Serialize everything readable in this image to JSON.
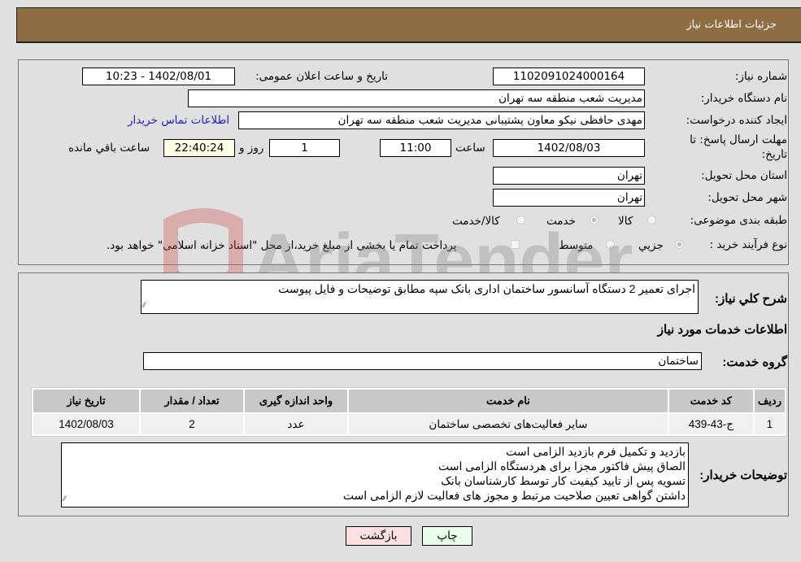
{
  "header": {
    "title": "جزئیات اطلاعات نیاز"
  },
  "form": {
    "need_number": {
      "label": "شماره نیاز:",
      "value": "1102091024000164"
    },
    "announce_datetime": {
      "label": "تاریخ و ساعت اعلان عمومی:",
      "value": "1402/08/01 - 10:23"
    },
    "buyer_org": {
      "label": "نام دستگاه خریدار:",
      "value": "مدیریت شعب منطقه سه تهران"
    },
    "requester": {
      "label": "ایجاد کننده درخواست:",
      "value": "مهدی حافظی نیکو معاون پشتیبانی مدیریت شعب منطقه سه تهران"
    },
    "contact_link": "اطلاعات تماس خریدار",
    "deadline": {
      "label_line1": "مهلت ارسال پاسخ: تا",
      "label_line2": "تاریخ:",
      "date": "1402/08/03",
      "time_label": "ساعت",
      "time": "11:00",
      "days": "1",
      "days_label": "روز و",
      "remaining": "22:40:24",
      "remaining_label": "ساعت باقي مانده"
    },
    "province": {
      "label": "استان محل تحویل:",
      "value": "تهران"
    },
    "city": {
      "label": "شهر محل تحویل:",
      "value": "تهران"
    },
    "category": {
      "label": "طبقه بندی موضوعی:",
      "options": [
        "کالا",
        "خدمت",
        "کالا/خدمت"
      ],
      "selected": "خدمت"
    },
    "purchase_type": {
      "label": "نوع فرآیند خرید :",
      "options": [
        "جزيي",
        "متوسط"
      ],
      "selected": "جزيي",
      "treasury_note": "پرداخت تمام یا بخشی از مبلغ خرید،از محل \"اسناد خزانه اسلامی\" خواهد بود."
    }
  },
  "details": {
    "description_label": "شرح کلي نياز:",
    "description": "اجرای تعمیر 2 دستگاه آسانسور ساختمان اداری بانک سپه مطابق توضیحات و فایل پیوست",
    "services_title": "اطلاعات خدمات مورد نیاز",
    "service_group_label": "گروه خدمت:",
    "service_group": "ساختمان",
    "table": {
      "headers": [
        "ردیف",
        "کد خدمت",
        "نام خدمت",
        "واحد اندازه گیری",
        "تعداد / مقدار",
        "تاریخ نیاز"
      ],
      "rows": [
        [
          "1",
          "ج-43-439",
          "سایر فعالیت‌های تخصصی ساختمان",
          "عدد",
          "2",
          "1402/08/03"
        ]
      ]
    },
    "buyer_notes_label": "توضیحات خریدار:",
    "buyer_notes": [
      "بازدید و تکمیل فرم بازدید الزامی است",
      "الصاق پیش فاکتور مجزا برای هردستگاه الزامی است",
      "تسویه پس از تایید کیفیت کار توسط کارشناسان بانک",
      "داشتن گواهی تعیین صلاحیت مرتبط و مجوز های فعالیت لازم الزامی است"
    ]
  },
  "buttons": {
    "print": "چاپ",
    "back": "بازگشت"
  },
  "colors": {
    "header_bg": "#8e6d42",
    "print_bg": "#eaffea",
    "back_bg": "#ffe0e0",
    "link": "#2020c0"
  },
  "watermark": {
    "text": "AriaTender.neT"
  }
}
